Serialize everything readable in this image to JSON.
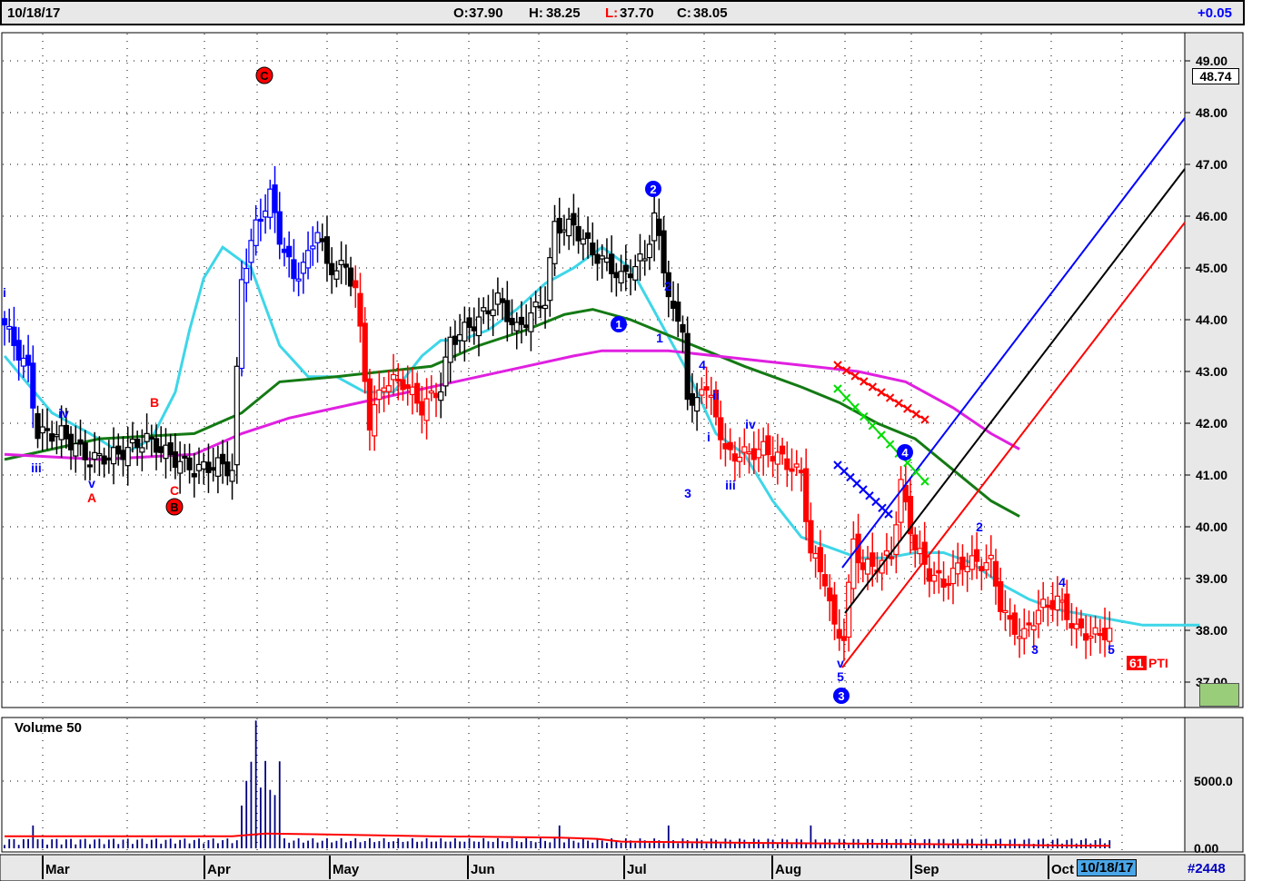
{
  "header": {
    "date": "10/18/17",
    "open_label": "O:",
    "open": "37.90",
    "high_label": "H:",
    "high": "38.25",
    "low_label": "L:",
    "low": "37.70",
    "close_label": "C:",
    "close": "38.05",
    "change": "+0.05"
  },
  "colors": {
    "up_bar": "#0000ff",
    "down_bar": "#ff0000",
    "neutral_bar": "#000000",
    "ma_short": "#3ed6e8",
    "ma_mid": "#147a14",
    "ma_long": "#e020e0",
    "volume": "#000080",
    "volume_ma": "#ff0000",
    "grid": "#000000"
  },
  "chart_data": [
    {
      "type": "candlestick",
      "grid": true,
      "x_axis_labels": [
        "Mar",
        "Apr",
        "May",
        "Jun",
        "Jul",
        "Aug",
        "Sep",
        "Oct"
      ],
      "y_ticks": [
        "49.00",
        "48.00",
        "47.00",
        "46.00",
        "45.00",
        "44.00",
        "43.00",
        "42.00",
        "41.00",
        "40.00",
        "39.00",
        "38.00",
        "37.00"
      ],
      "ylim": [
        36.5,
        49.6
      ],
      "last_price": "48.74",
      "date_tag": "10/18/17",
      "bar_count": "#2448",
      "indicator_badge": {
        "value": "61",
        "label": "PTI"
      },
      "wave_labels_blue": [
        "i",
        "iii",
        "iv",
        "v",
        "1",
        "2",
        "1",
        "2",
        "4",
        "3",
        "ii",
        "i",
        "iii",
        "iv",
        "v",
        "5",
        "3",
        "4",
        "2",
        "3",
        "4",
        "5"
      ],
      "wave_labels_red": [
        "B",
        "A",
        "C",
        "B",
        "C"
      ],
      "series": [
        {
          "name": "short moving average",
          "x": [
            0,
            10,
            18,
            25,
            31,
            36,
            39,
            42,
            46,
            52,
            58,
            64,
            70,
            76,
            82,
            88,
            92,
            96,
            102,
            108,
            114,
            120,
            126,
            132,
            138,
            144,
            150,
            156,
            162,
            168,
            174,
            180,
            186,
            192,
            198,
            204,
            207,
            210,
            216,
            222,
            228,
            234,
            240,
            246,
            252
          ],
          "y": [
            43.3,
            42.2,
            41.8,
            41.4,
            41.7,
            42.6,
            43.8,
            44.8,
            45.4,
            45.0,
            43.5,
            42.9,
            42.9,
            42.6,
            42.6,
            43.3,
            43.6,
            43.6,
            43.8,
            44.2,
            44.7,
            45.0,
            45.4,
            45.0,
            44.0,
            43.0,
            41.8,
            41.4,
            40.5,
            39.8,
            39.6,
            39.4,
            39.4,
            39.5,
            39.5,
            39.3,
            39.1,
            38.9,
            38.6,
            38.4,
            38.3,
            38.2,
            38.1,
            38.1,
            38.1
          ]
        },
        {
          "name": "mid moving average",
          "x": [
            0,
            20,
            40,
            50,
            58,
            70,
            80,
            90,
            100,
            110,
            118,
            124,
            132,
            140,
            148,
            156,
            162,
            168,
            176,
            184,
            192,
            200,
            208,
            214
          ],
          "y": [
            41.3,
            41.7,
            41.8,
            42.2,
            42.8,
            42.9,
            43.0,
            43.1,
            43.5,
            43.8,
            44.1,
            44.2,
            44.0,
            43.7,
            43.4,
            43.1,
            42.9,
            42.7,
            42.4,
            42.0,
            41.7,
            41.1,
            40.5,
            40.2
          ]
        },
        {
          "name": "long moving average",
          "x": [
            0,
            20,
            40,
            50,
            60,
            70,
            80,
            90,
            100,
            110,
            120,
            126,
            132,
            140,
            150,
            160,
            170,
            180,
            190,
            200,
            208,
            214
          ],
          "y": [
            41.4,
            41.3,
            41.4,
            41.8,
            42.1,
            42.3,
            42.5,
            42.7,
            42.9,
            43.1,
            43.3,
            43.4,
            43.4,
            43.4,
            43.3,
            43.2,
            43.1,
            43.0,
            42.8,
            42.3,
            41.8,
            41.5
          ]
        }
      ]
    },
    {
      "type": "bar",
      "title": "Volume 50",
      "y_ticks": [
        "5000.0",
        "0.00"
      ],
      "ylim": [
        0,
        9000
      ],
      "note": "daily volume bars with moving average line"
    }
  ]
}
